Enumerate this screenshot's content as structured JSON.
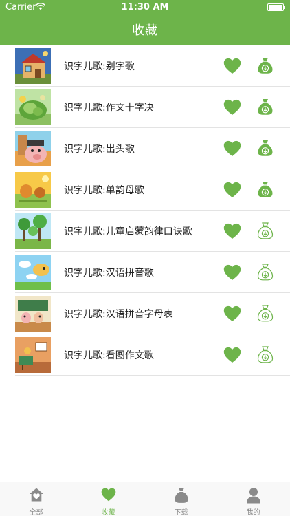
{
  "status_bar": {
    "carrier": "Carrier",
    "time": "11:30 AM"
  },
  "header": {
    "title": "收藏"
  },
  "colors": {
    "accent": "#6db44a",
    "inactive_tab": "#8a8a8a"
  },
  "items": [
    {
      "title": "识字儿歌:别字歌",
      "favorited": true,
      "downloaded": true
    },
    {
      "title": "识字儿歌:作文十字决",
      "favorited": true,
      "downloaded": true
    },
    {
      "title": "识字儿歌:出头歌",
      "favorited": true,
      "downloaded": true
    },
    {
      "title": "识字儿歌:单韵母歌",
      "favorited": true,
      "downloaded": true
    },
    {
      "title": "识字儿歌:儿童启蒙韵律口诀歌",
      "favorited": true,
      "downloaded": false
    },
    {
      "title": "识字儿歌:汉语拼音歌",
      "favorited": true,
      "downloaded": false
    },
    {
      "title": "识字儿歌:汉语拼音字母表",
      "favorited": true,
      "downloaded": false
    },
    {
      "title": "识字儿歌:看图作文歌",
      "favorited": true,
      "downloaded": false
    }
  ],
  "tabs": [
    {
      "label": "全部",
      "icon": "house-heart-icon",
      "active": false
    },
    {
      "label": "收藏",
      "icon": "heart-icon",
      "active": true
    },
    {
      "label": "下载",
      "icon": "download-bag-icon",
      "active": false
    },
    {
      "label": "我的",
      "icon": "person-icon",
      "active": false
    }
  ]
}
